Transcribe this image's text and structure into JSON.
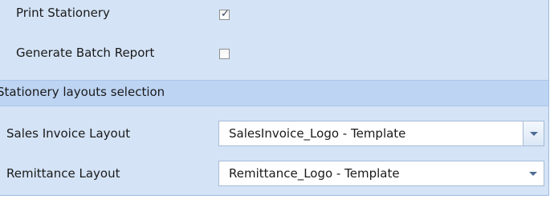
{
  "options": {
    "print_stationery": {
      "label": "Print Stationery",
      "checked": true
    },
    "generate_batch_report": {
      "label": "Generate Batch Report",
      "checked": false
    }
  },
  "section": {
    "title": "Stationery layouts selection"
  },
  "fields": {
    "sales_invoice_layout": {
      "label": "Sales Invoice Layout",
      "value": "SalesInvoice_Logo - Template"
    },
    "remittance_layout": {
      "label": "Remittance Layout",
      "value": "Remittance_Logo - Template"
    }
  },
  "icons": {
    "check": "checkmark-icon",
    "dropdown": "chevron-down-icon"
  },
  "colors": {
    "panel_background": "#d4e3f6",
    "section_header": "#bdd4f3",
    "border": "#a7bcd6",
    "arrow": "#4d6b93"
  }
}
